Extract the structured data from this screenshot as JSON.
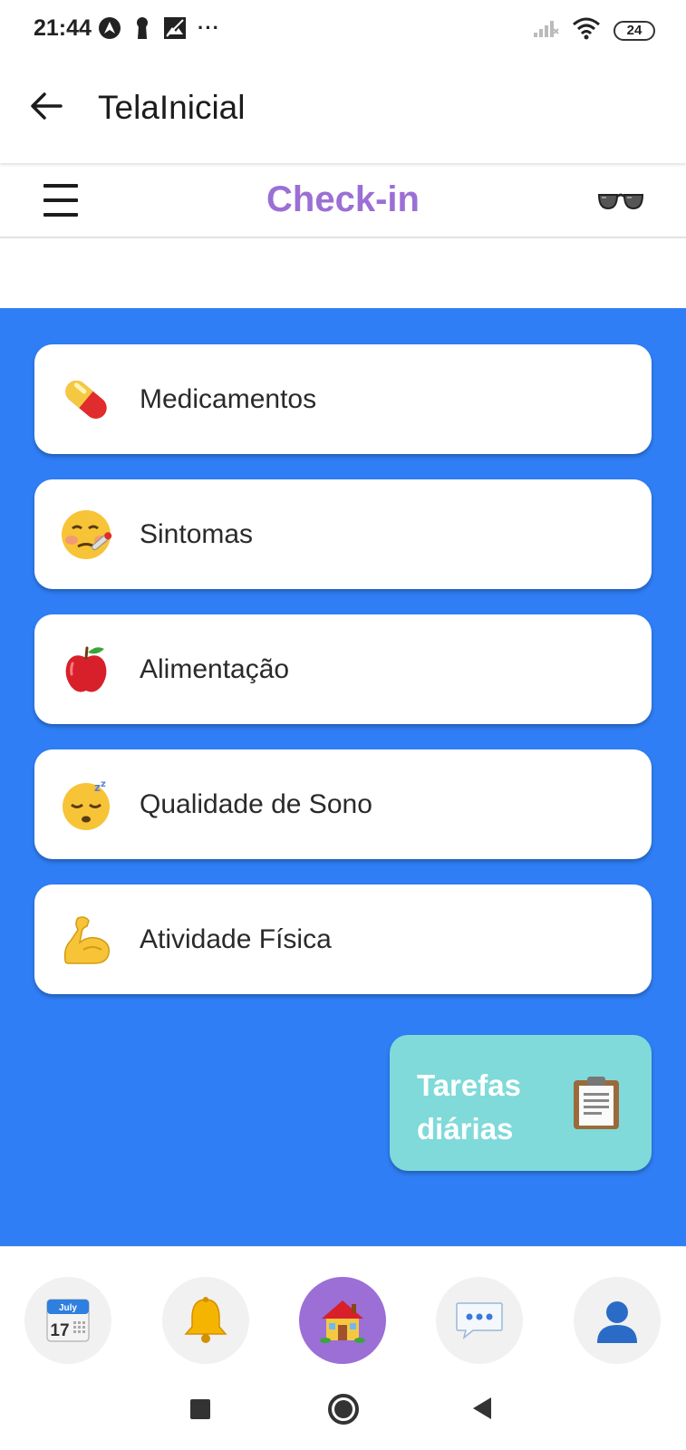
{
  "status_bar": {
    "time": "21:44",
    "icons": [
      "android-auto-icon",
      "keyhole-icon",
      "image-icon",
      "more-dots-icon"
    ],
    "dots": "···",
    "battery": "24"
  },
  "app_bar": {
    "title": "TelaInicial"
  },
  "checkin": {
    "title": "Check-in",
    "title_color": "#9b6fd6"
  },
  "menu_items": [
    {
      "label": "Medicamentos",
      "icon": "pill-icon"
    },
    {
      "label": "Sintomas",
      "icon": "sick-face-icon"
    },
    {
      "label": "Alimentação",
      "icon": "apple-icon"
    },
    {
      "label": "Qualidade de Sono",
      "icon": "sleeping-face-icon"
    },
    {
      "label": "Atividade Física",
      "icon": "flexed-biceps-icon"
    }
  ],
  "daily_tasks": {
    "label": "Tarefas diárias",
    "icon": "clipboard-icon"
  },
  "bottom_nav": {
    "calendar_month": "July",
    "calendar_day": "17",
    "items": [
      "calendar-icon",
      "bell-icon",
      "house-icon",
      "chat-icon",
      "user-icon"
    ],
    "active": "house-icon"
  },
  "colors": {
    "content_bg": "#2f7ef5",
    "accent_purple": "#9b6fd6",
    "tasks_bg": "#7fdad9"
  }
}
